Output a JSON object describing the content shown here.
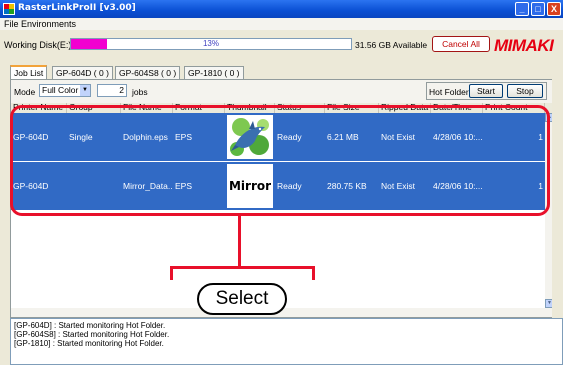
{
  "window": {
    "title": "RasterLinkProII  [v3.00]",
    "controls": [
      "_",
      "□",
      "X"
    ]
  },
  "menu": {
    "items": [
      "File",
      "Environments"
    ]
  },
  "disk": {
    "label": "Working Disk(E:)",
    "usage_percent": 13,
    "usage_text": "13%",
    "available": "31.56 GB Available",
    "cancel_all_label": "Cancel All",
    "logo_text": "MIMAKI",
    "progress_color": "#f200d0"
  },
  "tabs": [
    {
      "label": "Job List",
      "active": true
    },
    {
      "label": "GP-604D ( 0 )",
      "active": false
    },
    {
      "label": "GP-604S8 ( 0 )",
      "active": false
    },
    {
      "label": "GP-1810 ( 0 )",
      "active": false
    }
  ],
  "toolbar": {
    "mode_label": "Mode",
    "mode_value": "Full Color",
    "jobs_count": "2",
    "jobs_label": "jobs",
    "hotfolder_label": "Hot Folder",
    "start_label": "Start",
    "stop_label": "Stop"
  },
  "table": {
    "columns": [
      "Printer Name",
      "Group",
      "File Name",
      "Format",
      "Thumbnail",
      "Status",
      "File Size",
      "Ripped Data",
      "Date/Time",
      "Print Count"
    ],
    "rows": [
      {
        "printer": "GP-604D",
        "group": "Single",
        "file": "Dolphin.eps",
        "format": "EPS",
        "thumbnail": "dolphin-image",
        "status": "Ready",
        "size": "6.21 MB",
        "ripped": "Not Exist",
        "datetime": "4/28/06 10:...",
        "count": "1"
      },
      {
        "printer": "GP-604D",
        "group": "",
        "file": "Mirror_Data...",
        "format": "EPS",
        "thumbnail": "Mirror",
        "status": "Ready",
        "size": "280.75 KB",
        "ripped": "Not Exist",
        "datetime": "4/28/06 10:...",
        "count": "1"
      }
    ],
    "selection_color": "#316ac5"
  },
  "annotation": {
    "label": "Select",
    "color": "#e8102a"
  },
  "log": {
    "lines": [
      "[GP-604D] : Started monitoring Hot Folder.",
      "[GP-604S8] : Started monitoring Hot Folder.",
      "[GP-1810] : Started monitoring Hot Folder."
    ]
  }
}
